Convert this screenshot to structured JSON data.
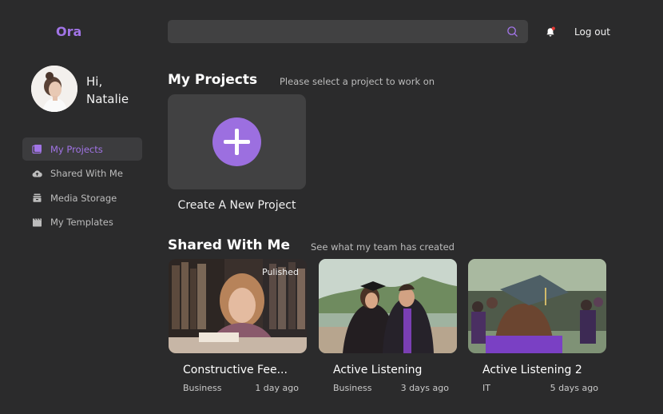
{
  "app": {
    "logo": "Ora"
  },
  "header": {
    "search_placeholder": "",
    "logout_label": "Log out"
  },
  "user": {
    "greeting_line1": "Hi,",
    "greeting_line2": "Natalie"
  },
  "sidebar": {
    "items": [
      {
        "label": "My Projects",
        "icon": "folder-icon",
        "active": true
      },
      {
        "label": "Shared With Me",
        "icon": "cloud-upload-icon",
        "active": false
      },
      {
        "label": "Media Storage",
        "icon": "archive-icon",
        "active": false
      },
      {
        "label": "My Templates",
        "icon": "film-icon",
        "active": false
      }
    ]
  },
  "my_projects": {
    "title": "My Projects",
    "subtitle": "Please select a project to work on",
    "create_label": "Create A New Project"
  },
  "shared": {
    "title": "Shared With Me",
    "subtitle": "See what my team has created",
    "cards": [
      {
        "title": "Constructive Fee...",
        "category": "Business",
        "time": "1 day ago",
        "badge": "Pulished"
      },
      {
        "title": "Active Listening",
        "category": "Business",
        "time": "3 days ago",
        "badge": ""
      },
      {
        "title": "Active Listening 2",
        "category": "IT",
        "time": "5 days ago",
        "badge": ""
      }
    ]
  },
  "colors": {
    "accent": "#a174e6",
    "background": "#2b2b2c",
    "card": "#414142",
    "notification": "#e53935"
  }
}
